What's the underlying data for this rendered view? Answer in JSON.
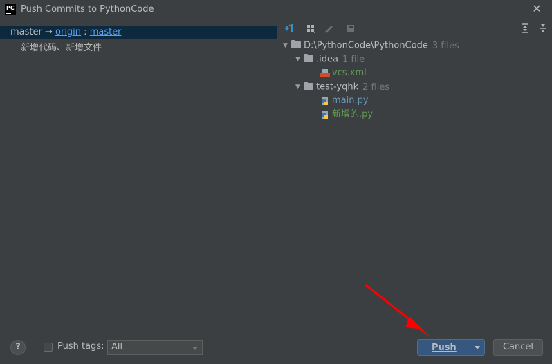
{
  "window": {
    "title": "Push Commits to PythonCode",
    "logo_text": "PC",
    "close_glyph": "✕"
  },
  "commit": {
    "local_branch": "master",
    "arrow": " → ",
    "remote": "origin",
    "separator": " : ",
    "remote_branch": "master",
    "message": "新增代码、新增文件"
  },
  "toolbar": {
    "icons": [
      "collapse-arrows-icon",
      "group-by-icon",
      "edit-icon",
      "diff-icon",
      "expand-all-icon",
      "collapse-all-icon"
    ]
  },
  "tree": {
    "root": {
      "label": "D:\\PythonCode\\PythonCode",
      "count": "3 files"
    },
    "folders": [
      {
        "label": ".idea",
        "count": "1 file",
        "files": [
          {
            "label": "vcs.xml"
          }
        ]
      },
      {
        "label": "test-yqhk",
        "count": "2 files",
        "files": [
          {
            "label": "main.py"
          },
          {
            "label": "新增的.py"
          }
        ]
      }
    ]
  },
  "bottom": {
    "help": "?",
    "push_tags_label": "Push tags:",
    "push_tags_value": "All",
    "push_label": "Push",
    "cancel_label": "Cancel"
  },
  "colors": {
    "accent": "#365880",
    "link": "#589df6",
    "selection": "#0d293e",
    "new_file": "#629755",
    "modified_file": "#6897bb",
    "annotation_arrow": "#ff0000"
  }
}
